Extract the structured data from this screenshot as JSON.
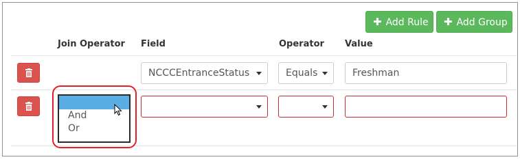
{
  "toolbar": {
    "add_rule_label": "Add Rule",
    "add_group_label": "Add Group"
  },
  "columns": {
    "join_operator": "Join Operator",
    "field": "Field",
    "operator": "Operator",
    "value": "Value"
  },
  "rows": [
    {
      "join_operator": "",
      "field": "NCCCEntranceStatus",
      "operator": "Equals",
      "value": "Freshman"
    },
    {
      "join_operator": "",
      "field": "",
      "operator": "",
      "value": ""
    }
  ],
  "join_dropdown": {
    "options": [
      "",
      "And",
      "Or"
    ],
    "highlighted_index": 0
  },
  "colors": {
    "success": "#5cb85c",
    "danger": "#d9534f",
    "error_border": "#c9302c",
    "selection": "#5aaee4",
    "callout": "#e31e24"
  },
  "icons": {
    "add": "plus-icon",
    "delete": "trash-icon",
    "dropdown": "caret-down-icon",
    "pointer": "mouse-cursor-icon"
  }
}
